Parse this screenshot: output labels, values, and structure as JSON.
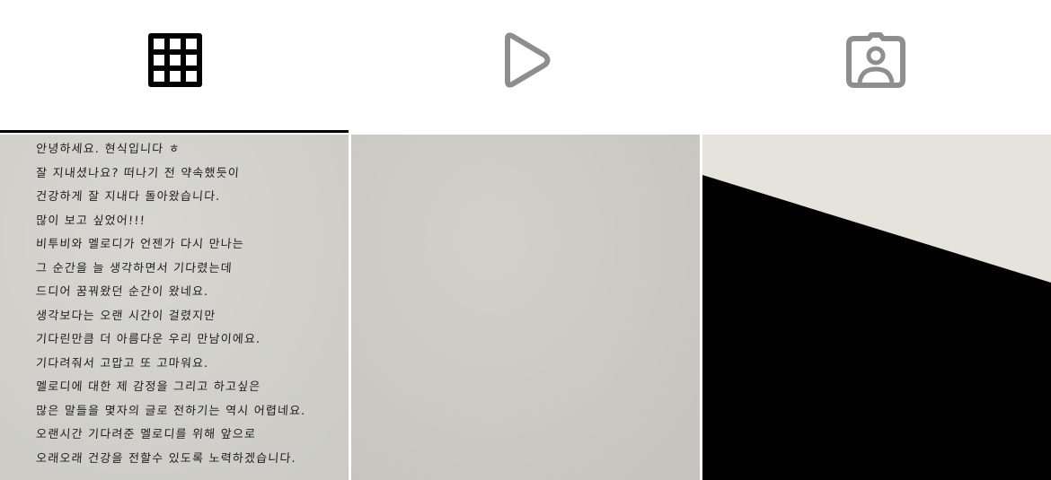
{
  "tabs": [
    {
      "id": "posts",
      "icon": "grid-icon",
      "active": true,
      "color": "#000000"
    },
    {
      "id": "reels",
      "icon": "play-icon",
      "active": false,
      "color": "#8e8e8e"
    },
    {
      "id": "tagged",
      "icon": "tagged-person-icon",
      "active": false,
      "color": "#8e8e8e"
    }
  ],
  "colors": {
    "active_indicator": "#000000",
    "inactive_icon": "#8e8e8e",
    "background": "#ffffff"
  },
  "posts": [
    {
      "type": "handwritten-letter",
      "lines": [
        "안녕하세요. 현식입니다 ㅎ",
        "잘 지내셨나요? 떠나기 전 약속했듯이",
        "건강하게 잘 지내다 돌아왔습니다.",
        "많이 보고 싶었어!!!",
        "비투비와 멜로디가 언젠가 다시 만나는",
        "그 순간을 늘 생각하면서 기다렸는데",
        "드디어 꿈꿔왔던 순간이 왔네요.",
        "생각보다는 오랜 시간이 걸렸지만",
        "기다린만큼 더 아름다운 우리 만남이에요.",
        "기다려줘서 고맙고 또 고마워요.",
        "멜로디에 대한 제 감정을 그리고 하고싶은",
        "많은 말들을 몇자의 글로 전하기는 역시 어렵네요.",
        "오랜시간 기다려준 멜로디를 위해 앞으로",
        "오래오래 건강을 전할수 있도록 노력하겠습니다."
      ]
    },
    {
      "type": "blank-paper"
    },
    {
      "type": "black-diagonal"
    }
  ]
}
